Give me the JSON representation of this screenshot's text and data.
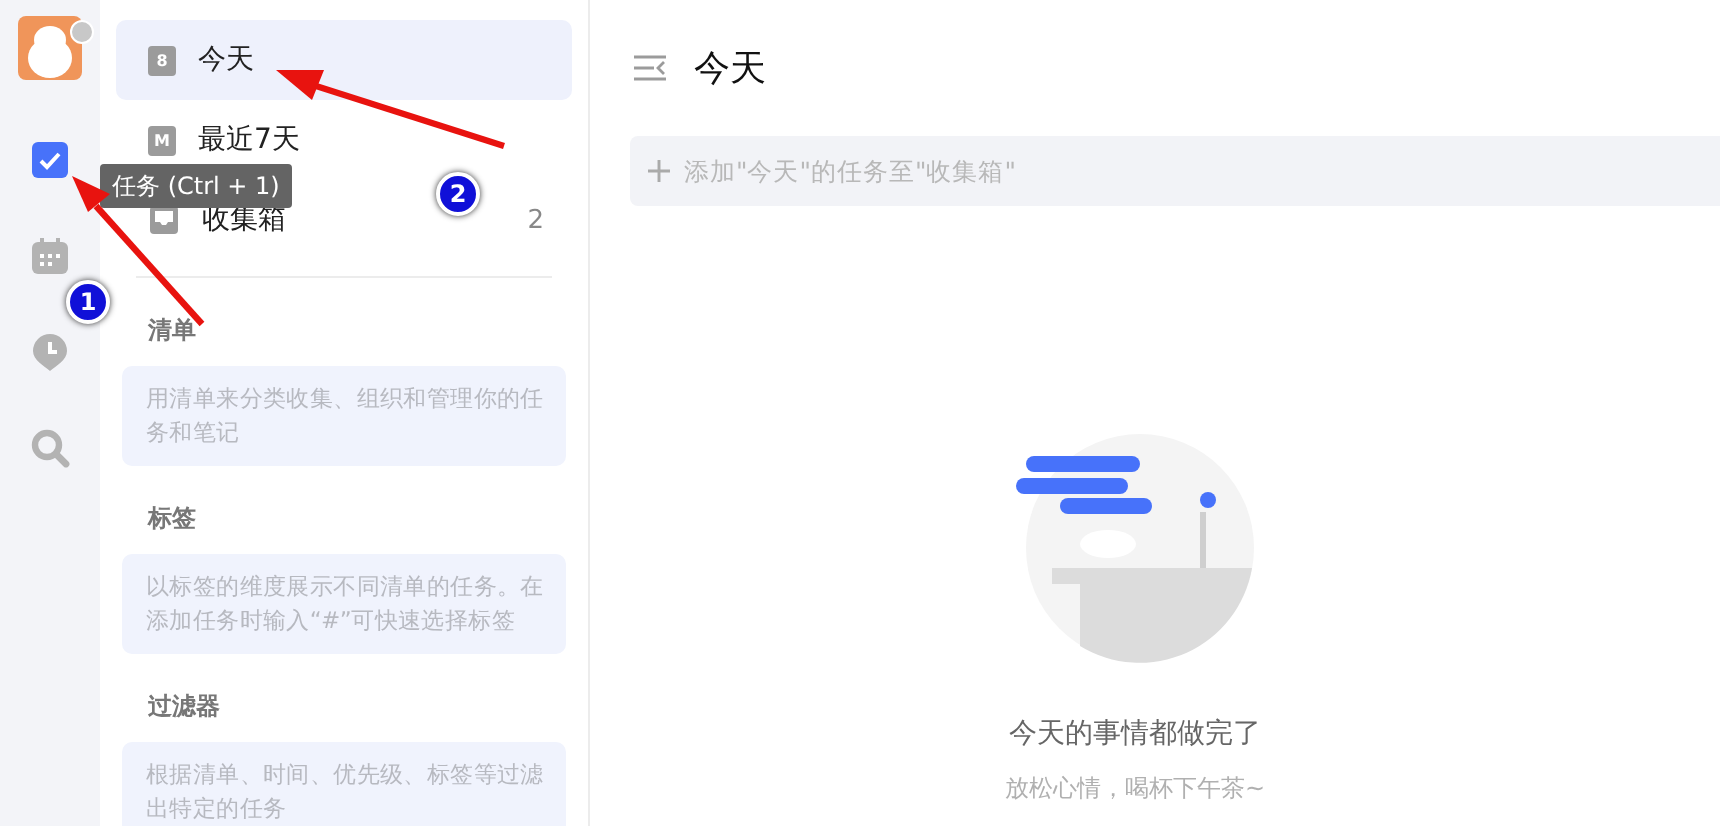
{
  "rail": {
    "items": [
      {
        "kind": "tasks",
        "selected": true
      },
      {
        "kind": "calendar",
        "selected": false
      },
      {
        "kind": "clock",
        "selected": false
      },
      {
        "kind": "search",
        "selected": false
      }
    ]
  },
  "tooltip": {
    "text": "任务 (Ctrl + 1)"
  },
  "sidebar": {
    "items": [
      {
        "kind": "today",
        "icon_text": "8",
        "label": "今天",
        "selected": true
      },
      {
        "kind": "week",
        "icon_text": "M",
        "label": "最近7天",
        "selected": false
      },
      {
        "kind": "inbox",
        "label": "收集箱",
        "count": "2",
        "selected": false
      }
    ],
    "sections": [
      {
        "title": "清单",
        "hint": "用清单来分类收集、组织和管理你的任务和笔记"
      },
      {
        "title": "标签",
        "hint": "以标签的维度展示不同清单的任务。在添加任务时输入“#”可快速选择标签"
      },
      {
        "title": "过滤器",
        "hint": "根据清单、时间、优先级、标签等过滤出特定的任务"
      }
    ]
  },
  "main": {
    "title": "今天",
    "add_placeholder": "添加\"今天\"的任务至\"收集箱\"",
    "empty_title": "今天的事情都做完了",
    "empty_subtitle": "放松心情，喝杯下午茶~"
  },
  "annotations": [
    {
      "number": "1"
    },
    {
      "number": "2"
    }
  ]
}
